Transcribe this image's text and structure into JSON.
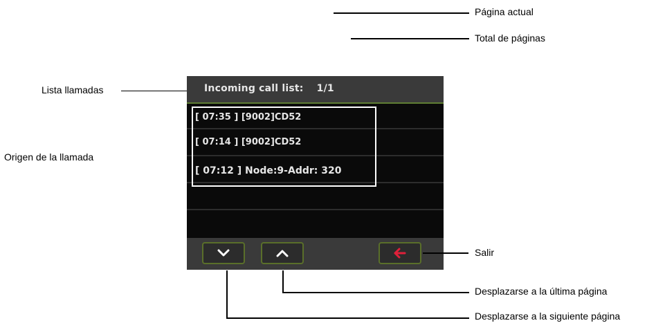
{
  "screen": {
    "header_title": "Incoming call list:",
    "page_indicator": "1/1",
    "calls": [
      "[ 07:35 ] [9002]CD52",
      "[ 07:14 ] [9002]CD52",
      "[ 07:12 ] Node:9-Addr: 320"
    ]
  },
  "callouts": {
    "current_page": "Página actual",
    "total_pages": "Total de páginas",
    "call_list": "Lista llamadas",
    "call_origin": "Origen de la llamada",
    "exit": "Salir",
    "last_page": "Desplazarse a la última página",
    "next_page": "Desplazarse a la siguiente página"
  },
  "icons": {
    "down_button": "chevron-down-icon",
    "up_button": "chevron-up-icon",
    "exit_button": "arrow-left-icon"
  },
  "colors": {
    "screen_background": "#0a0a0a",
    "bar_background": "#3a3a3a",
    "accent_green": "#5f7f33",
    "exit_arrow": "#e0203a",
    "text": "#e6e6e6"
  }
}
